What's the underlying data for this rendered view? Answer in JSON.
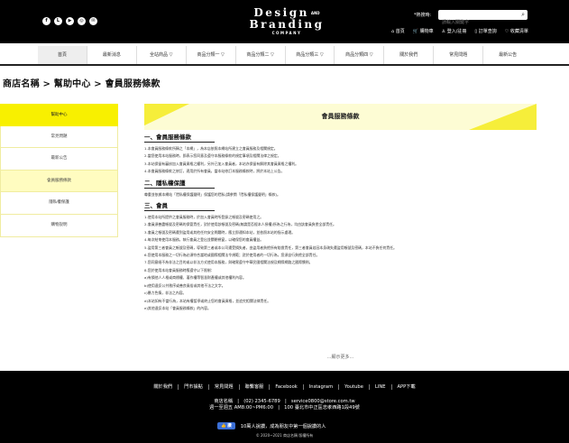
{
  "header": {
    "social_icons": [
      "facebook-icon",
      "line-icon",
      "youtube-icon",
      "instagram-icon",
      "email-icon"
    ],
    "logo": {
      "line1": "Design",
      "line1_small": "AND",
      "line2": "Branding",
      "line3": "COMPANY"
    },
    "search_label": "*熱搜時:",
    "search_placeholder": "請輸入關鍵字",
    "user_links": [
      "首頁",
      "購物車",
      "登入/註冊",
      "訂單查詢",
      "收藏清單"
    ]
  },
  "nav": {
    "items": [
      "首頁",
      "最新消息",
      "全站商品 ▽",
      "商品分類一 ▽",
      "商品分類二 ▽",
      "商品分類三 ▽",
      "商品分類四 ▽",
      "關於我們",
      "常見問題",
      "最新公告"
    ],
    "active_index": 0
  },
  "breadcrumb": "商店名稱 > 幫助中心 > 會員服務條款",
  "sidebar": {
    "items": [
      "幫助中心",
      "常見問題",
      "最新公告",
      "會員服務條款",
      "隱私權保護",
      "購物說明"
    ],
    "active_index": 0,
    "highlight_index": 3
  },
  "content": {
    "banner_title": "會員服務條款",
    "sections": [
      {
        "heading": "一、會員服務條款",
        "paragraphs": [
          "1.本會員服務條款所稱之「本網」，為本店依照本網站所建立之會員服務及相關規定。",
          "2.當您使用本站服務時，即表示您同意及遵守本服務條款的規定事項及相關法律之規定。",
          "3.本站保留有審核加入會員資格之權利，另外已加入會員者，本站亦保留有解除其會員資格之權利。",
          "4.本會員服務條款之修訂，適用於所有會員，當本站修訂本服務條款時，將於本站上公告。"
        ]
      },
      {
        "heading": "二、隱私權保護",
        "paragraphs": [
          "尊重並依據本網站「隱私權保護聲明」保護您的隱私(請參閱「隱私權保護聲明」條款)。"
        ]
      },
      {
        "heading": "三、會員",
        "paragraphs": [
          "1.使用本站所提供之會員服務時，於加入會員時所登錄之帳號及密碼使用之。",
          "2.會員須善盡帳號及密碼的保管責任，對於使用該帳號及密碼(無論是否經本人授權)所為之行為，均由該會員負擔全部責任。",
          "3.會員之帳號及密碼遭到盜用或其他任何安全問題時，應立即通知本站，並依照本站的指示處理。",
          "4.每次結束使用本服務，執行會員之登出並關閉視窗，以確保您的會員權益。",
          "5.盜用第三者會員之帳號及密碼，導致第三者或本公司遭受損失者，由盜用者負擔所有賠償責任，第三者會員若因本身疏失遭盜用帳號及密碼，本站不負任何責任。",
          "6.您使用本服務之一切行為必須符合當地或國際相關法令規範；對於使用者的一切行為，您須自行負擔全部責任。",
          "7.您同意絕不為非法之目的或以非法方式使用本服務，與確實遵守中華民國相關法規及網際網路之國際慣例。",
          "8.您於使用本站會員服務時應遵守以下限制：",
          "a)有損他人人格或商標權、著作權等智慧財產權或其他權利內容。",
          "b)使用違反公共秩序或善良風俗或其他不法之文字。",
          "c)暴力色情，非法之內容。",
          "d)本站如有不當行為，本站有權暫停或終止您的會員資格，並追究相關法律責任。",
          "e)其他違反本站「會員服務條款」的內容。"
        ]
      }
    ],
    "more_label": "...顯示更多..."
  },
  "footer": {
    "links": [
      "關於我們",
      "門市據點",
      "常見問題",
      "聯繫客服",
      "Facebook",
      "Instagram",
      "Youtube",
      "LINE",
      "APP下載"
    ],
    "info_line1": "商店名稱　|　(02) 2345-6789　|　service0800@store.com.tw",
    "info_line2": "週一至週五 AM8:00~PM6:00　|　100 臺北市中正區忠孝西路1段49號",
    "fb_button": "讚",
    "fb_text": "10萬人說讚，成為朋友中第一個說讚的人",
    "copyright": "© 2020~2021 商店名稱 版權所有"
  }
}
